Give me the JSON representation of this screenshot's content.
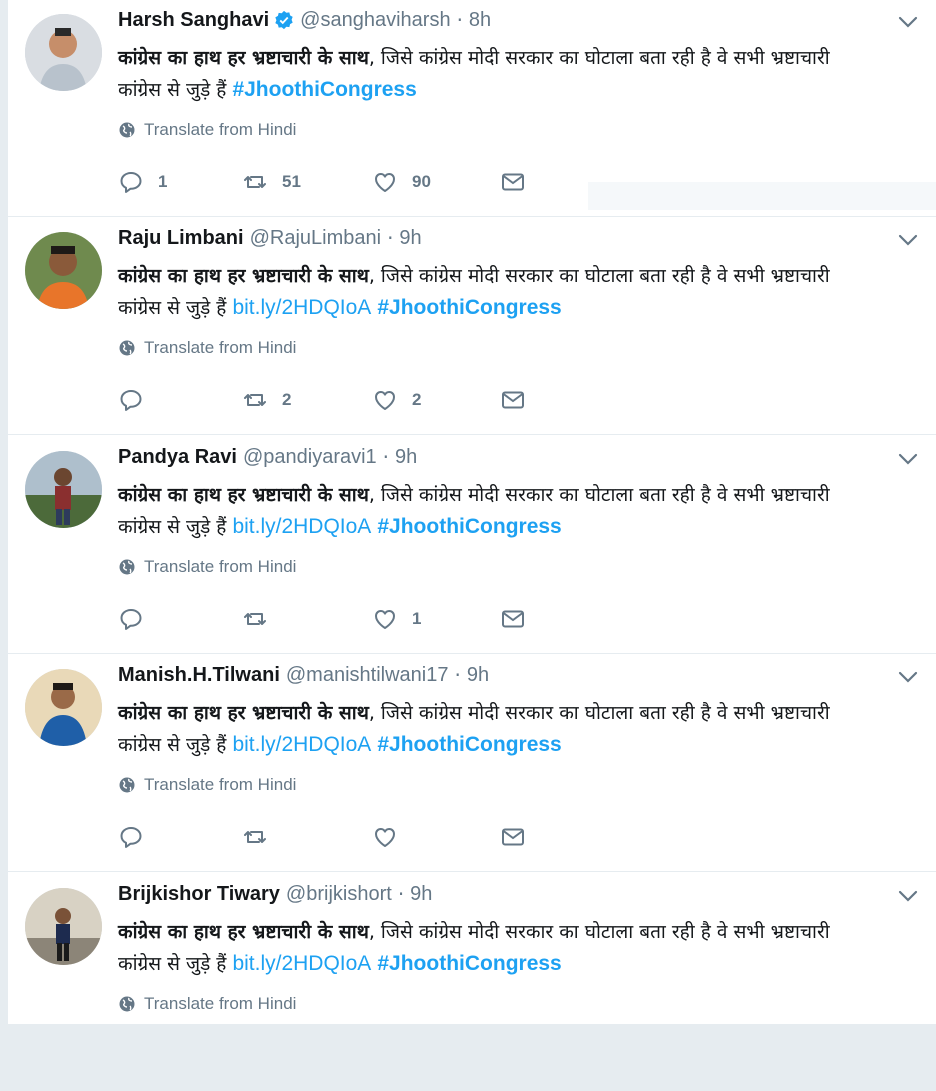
{
  "colors": {
    "accent": "#1da1f2",
    "muted": "#657786",
    "text": "#14171a"
  },
  "translate_label": "Translate from Hindi",
  "tweets": [
    {
      "name": "Harsh Sanghavi",
      "verified": true,
      "handle": "@sanghaviharsh",
      "time": "8h",
      "text_bold": "कांग्रेस का हाथ हर भ्रष्टाचारी के साथ",
      "text_rest": ", जिसे कांग्रेस मोदी सरकार का घोटाला बता रही है वे सभी भ्रष्टाचारी कांग्रेस से जुड़े हैं ",
      "link": "",
      "hashtag": "#JhoothiCongress",
      "replies": "1",
      "retweets": "51",
      "likes": "90"
    },
    {
      "name": "Raju Limbani",
      "verified": false,
      "handle": "@RajuLimbani",
      "time": "9h",
      "text_bold": "कांग्रेस का हाथ हर भ्रष्टाचारी के साथ",
      "text_rest": ", जिसे कांग्रेस मोदी सरकार का घोटाला बता रही है वे सभी भ्रष्टाचारी कांग्रेस से जुड़े हैं ",
      "link": "bit.ly/2HDQIoA",
      "hashtag": "#JhoothiCongress",
      "replies": "",
      "retweets": "2",
      "likes": "2"
    },
    {
      "name": "Pandya Ravi",
      "verified": false,
      "handle": "@pandiyaravi1",
      "time": "9h",
      "text_bold": "कांग्रेस का हाथ हर भ्रष्टाचारी के साथ",
      "text_rest": ", जिसे कांग्रेस मोदी सरकार का घोटाला बता रही है वे सभी भ्रष्टाचारी कांग्रेस से जुड़े हैं ",
      "link": "bit.ly/2HDQIoA",
      "hashtag": "#JhoothiCongress",
      "replies": "",
      "retweets": "",
      "likes": "1"
    },
    {
      "name": "Manish.H.Tilwani",
      "verified": false,
      "handle": "@manishtilwani17",
      "time": "9h",
      "text_bold": "कांग्रेस का हाथ हर भ्रष्टाचारी के साथ",
      "text_rest": ", जिसे कांग्रेस मोदी सरकार का घोटाला बता रही है वे सभी भ्रष्टाचारी कांग्रेस से जुड़े हैं ",
      "link": "bit.ly/2HDQIoA",
      "hashtag": "#JhoothiCongress",
      "replies": "",
      "retweets": "",
      "likes": ""
    },
    {
      "name": "Brijkishor Tiwary",
      "verified": false,
      "handle": "@brijkishort",
      "time": "9h",
      "text_bold": "कांग्रेस का हाथ हर भ्रष्टाचारी के साथ",
      "text_rest": ", जिसे कांग्रेस मोदी सरकार का घोटाला बता रही है वे सभी भ्रष्टाचारी कांग्रेस से जुड़े हैं ",
      "link": "bit.ly/2HDQIoA",
      "hashtag": "#JhoothiCongress",
      "replies": "",
      "retweets": "",
      "likes": ""
    }
  ]
}
